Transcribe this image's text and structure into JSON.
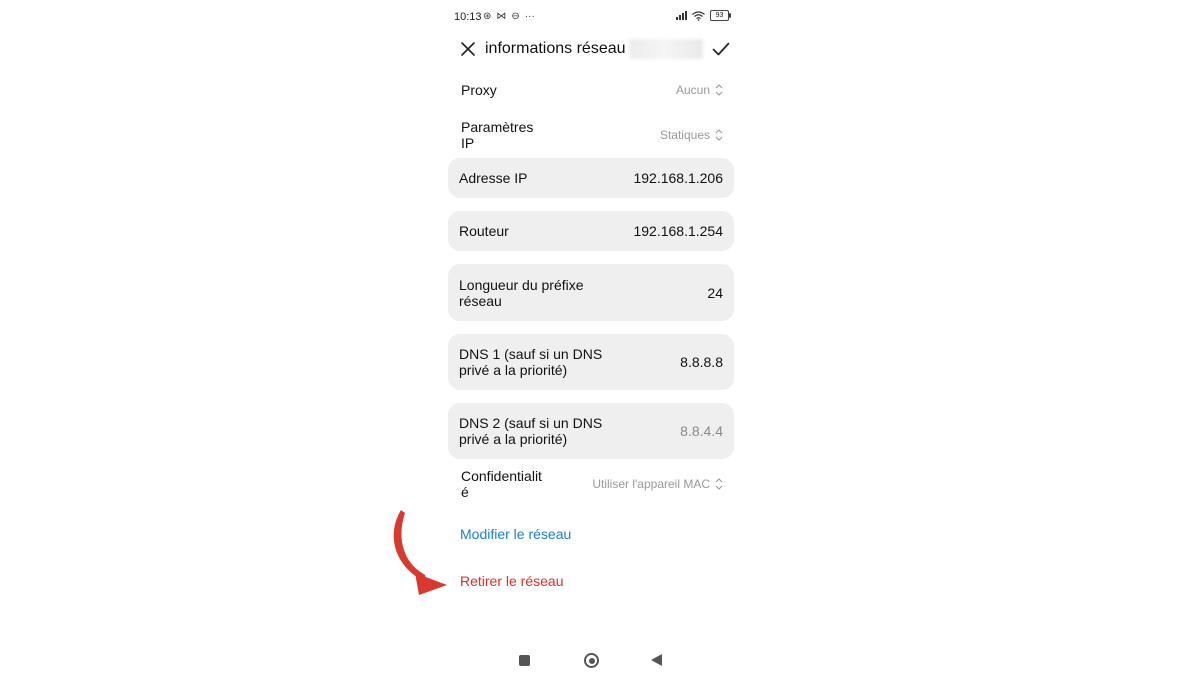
{
  "status_bar": {
    "time": "10:13",
    "battery": "93"
  },
  "header": {
    "title": "informations réseau"
  },
  "proxy": {
    "label": "Proxy",
    "value": "Aucun"
  },
  "ip_settings": {
    "label_line1": "Paramètres",
    "label_line2": "IP",
    "value": "Statiques"
  },
  "ip_address": {
    "label": "Adresse IP",
    "value": "192.168.1.206"
  },
  "router": {
    "label": "Routeur",
    "value": "192.168.1.254"
  },
  "prefix_length": {
    "label_line1": "Longueur du préfixe",
    "label_line2": "réseau",
    "value": "24"
  },
  "dns1": {
    "label_line1": "DNS 1 (sauf si un DNS",
    "label_line2": "privé a la priorité)",
    "value": "8.8.8.8"
  },
  "dns2": {
    "label_line1": "DNS 2 (sauf si un DNS",
    "label_line2": "privé a la priorité)",
    "value": "8.8.4.4"
  },
  "privacy": {
    "label_line1": "Confidentialit",
    "label_line2": "é",
    "value": "Utiliser l'appareil MAC"
  },
  "actions": {
    "modify": "Modifier le réseau",
    "remove": "Retirer le réseau"
  },
  "colors": {
    "link_blue": "#1a7fd4",
    "link_red": "#e32b2b",
    "card_bg": "#efefef",
    "annotation_arrow": "#d93a2f"
  },
  "icons": {
    "close": "close-icon",
    "confirm": "check-icon",
    "selector": "chevron-updown-icon",
    "annotation": "curved-arrow-icon"
  }
}
